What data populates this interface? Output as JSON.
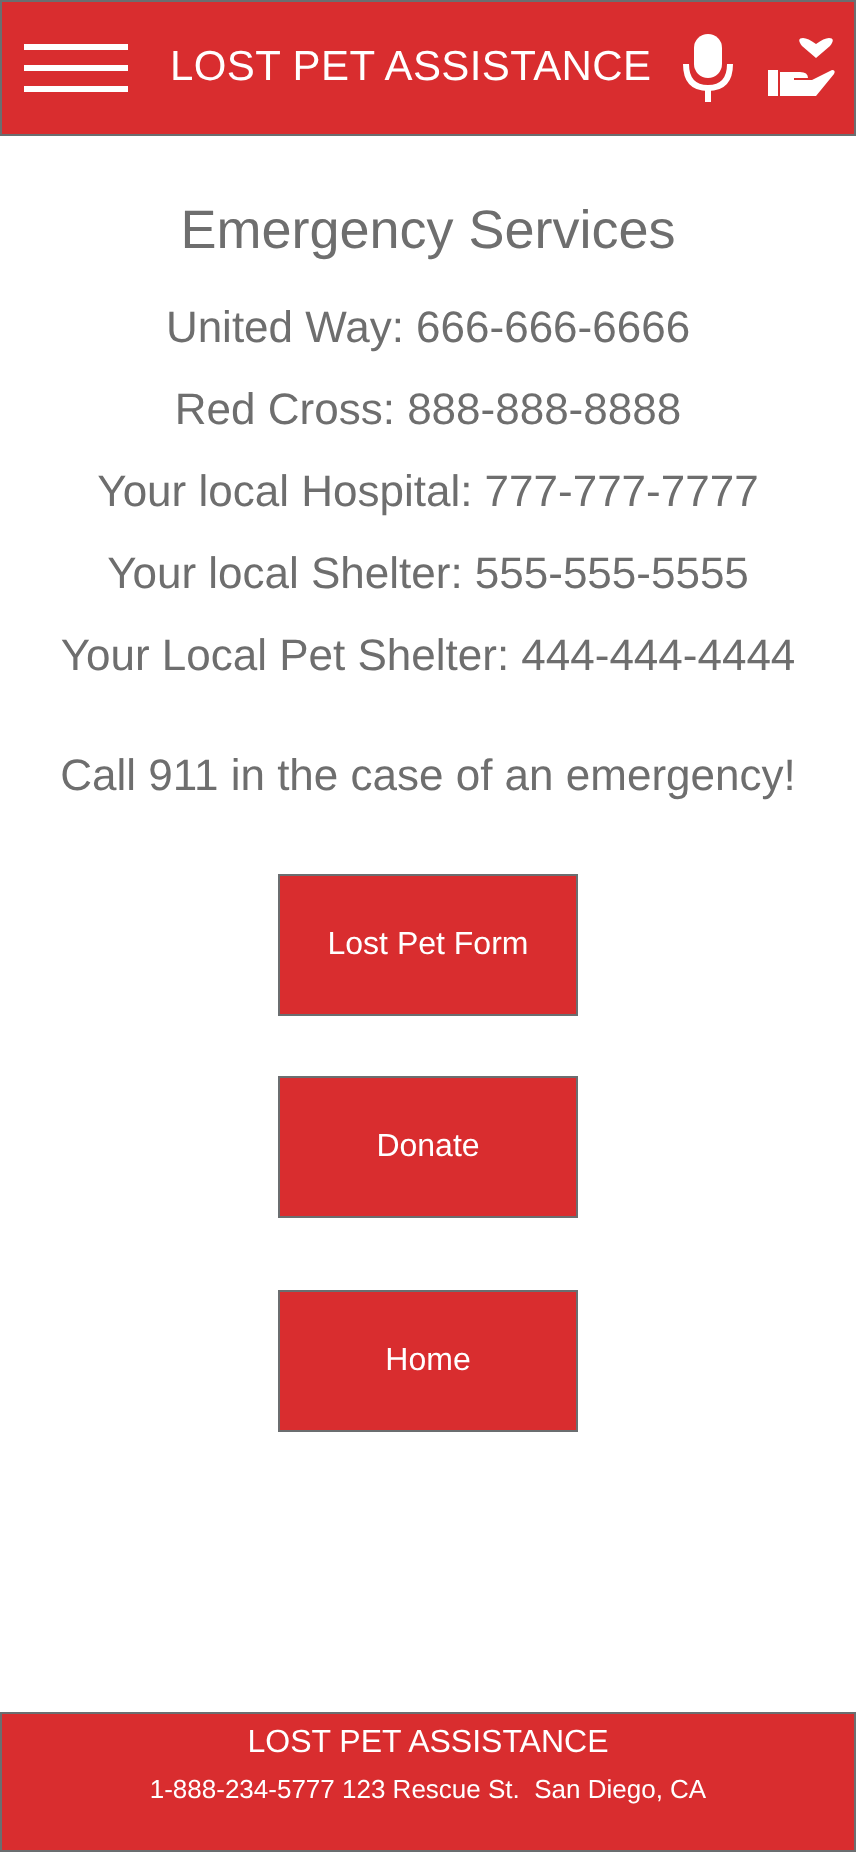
{
  "header": {
    "title": "LOST PET ASSISTANCE"
  },
  "heading": "Emergency Services",
  "contacts": [
    "United Way: 666-666-6666",
    "Red Cross: 888-888-8888",
    "Your local Hospital: 777-777-7777",
    "Your local Shelter: 555-555-5555",
    "Your Local Pet Shelter: 444-444-4444"
  ],
  "notice": "Call 911 in the case of an emergency!",
  "buttons": [
    "Lost Pet Form",
    "Donate",
    "Home"
  ],
  "footer": {
    "title": "LOST PET ASSISTANCE",
    "contact": "1-888-234-5777 123 Rescue St.  San Diego, CA"
  }
}
